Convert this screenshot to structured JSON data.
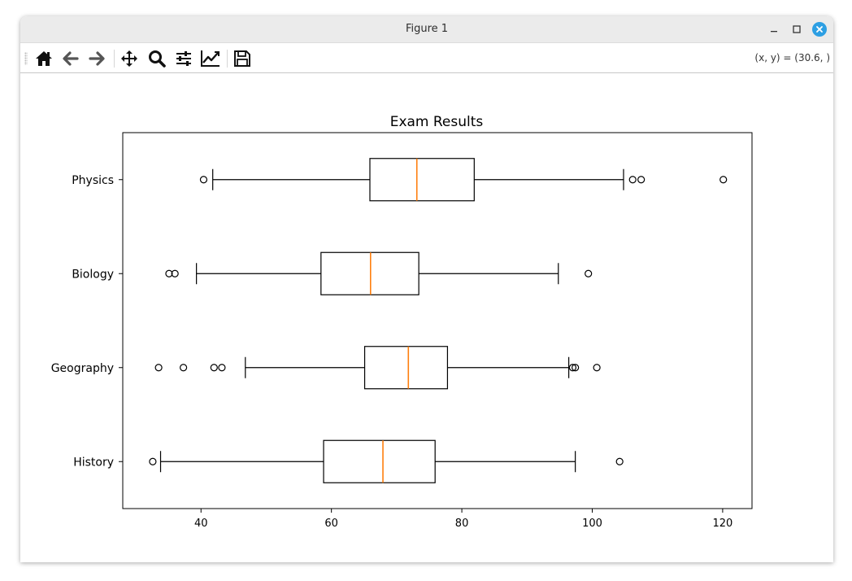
{
  "window": {
    "title": "Figure 1"
  },
  "toolbar": {
    "buttons": [
      {
        "name": "home",
        "icon": "home-icon"
      },
      {
        "name": "back",
        "icon": "arrow-left-icon"
      },
      {
        "name": "forward",
        "icon": "arrow-right-icon"
      },
      {
        "name": "pan",
        "icon": "move-icon"
      },
      {
        "name": "zoom",
        "icon": "magnifier-icon"
      },
      {
        "name": "configure-subplots",
        "icon": "sliders-icon"
      },
      {
        "name": "edit-axes",
        "icon": "line-chart-icon"
      },
      {
        "name": "save",
        "icon": "floppy-disk-icon"
      }
    ],
    "coords": "(x, y) = (30.6, )"
  },
  "chart_data": {
    "type": "boxplot",
    "orientation": "horizontal",
    "title": "Exam Results",
    "xlabel": "",
    "ylabel": "",
    "xlim": [
      28,
      124.5
    ],
    "xticks": [
      40,
      60,
      80,
      100,
      120
    ],
    "grid": false,
    "colors": {
      "box": "#000000",
      "median": "#ff7f0e"
    },
    "categories": [
      "History",
      "Geography",
      "Biology",
      "Physics"
    ],
    "series": [
      {
        "category": "History",
        "whislo": 33.8,
        "q1": 58.8,
        "med": 67.9,
        "q3": 75.9,
        "whishi": 97.4,
        "fliers": [
          32.6,
          104.2
        ]
      },
      {
        "category": "Geography",
        "whislo": 46.8,
        "q1": 65.1,
        "med": 71.8,
        "q3": 77.8,
        "whishi": 96.4,
        "fliers": [
          33.5,
          37.3,
          42.0,
          43.2,
          97.0,
          97.4,
          100.7
        ]
      },
      {
        "category": "Biology",
        "whislo": 39.3,
        "q1": 58.4,
        "med": 66.0,
        "q3": 73.4,
        "whishi": 94.8,
        "fliers": [
          35.1,
          36.0,
          99.4
        ]
      },
      {
        "category": "Physics",
        "whislo": 41.8,
        "q1": 65.9,
        "med": 73.1,
        "q3": 81.9,
        "whishi": 104.8,
        "fliers": [
          40.4,
          106.2,
          107.5,
          120.1
        ]
      }
    ]
  }
}
